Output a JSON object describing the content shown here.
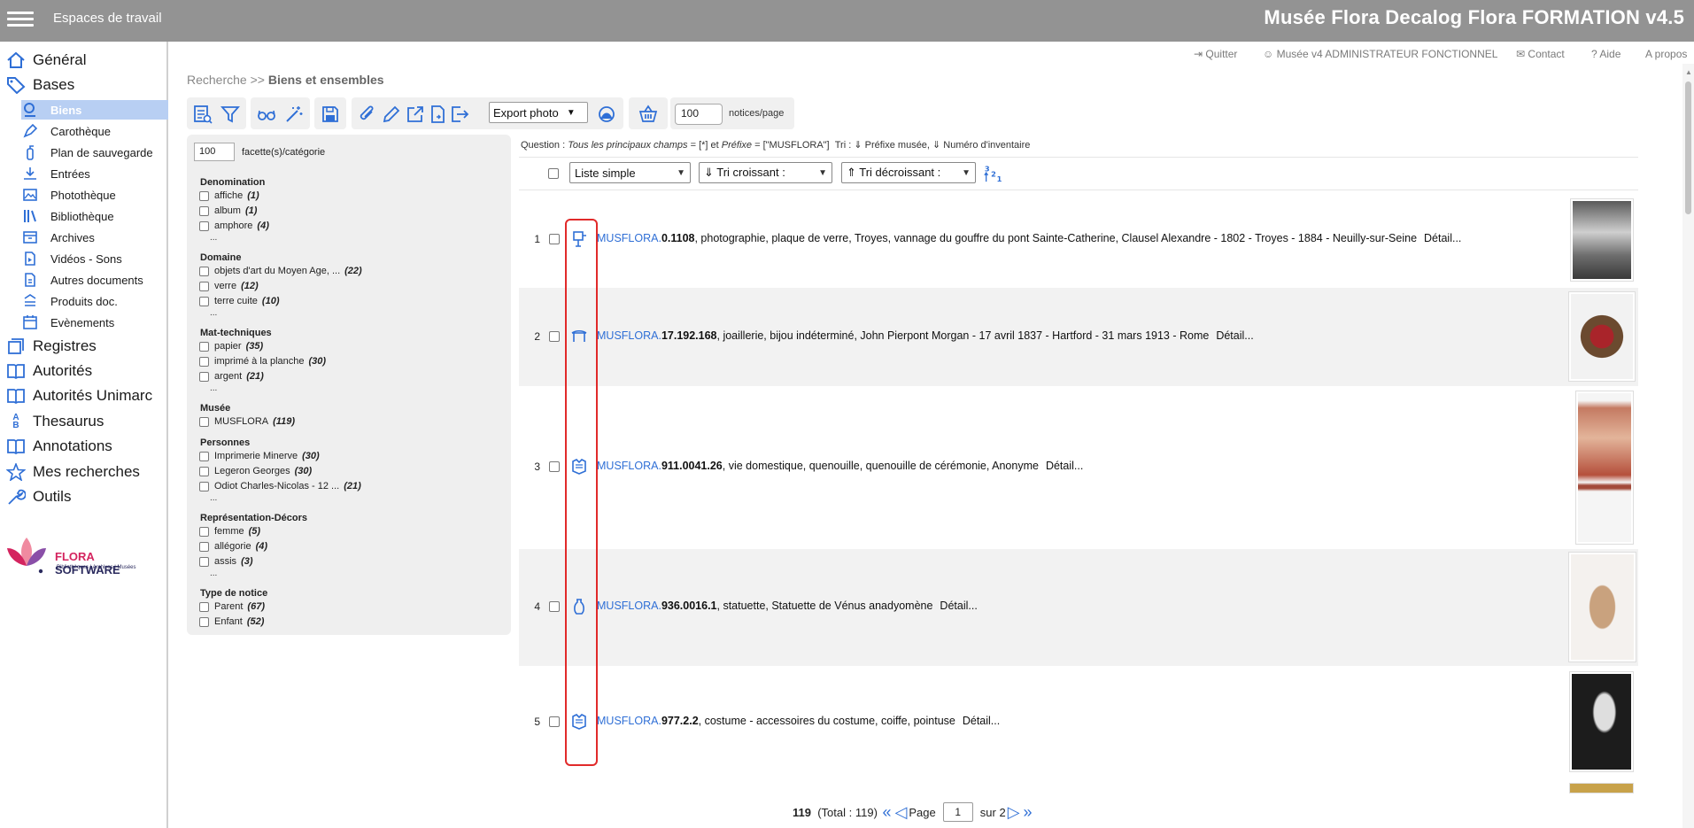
{
  "topbar": {
    "workspace": "Espaces de travail",
    "title": "Musée Flora Decalog Flora FORMATION v4.5"
  },
  "sidebar": {
    "top_items": [
      {
        "label": "Général",
        "icon": "home-icon"
      },
      {
        "label": "Bases",
        "icon": "tag-icon"
      }
    ],
    "sub_items": [
      {
        "label": "Biens",
        "icon": "object-search-icon",
        "active": true
      },
      {
        "label": "Carothèque",
        "icon": "pen-icon"
      },
      {
        "label": "Plan de sauvegarde",
        "icon": "extinguisher-icon"
      },
      {
        "label": "Entrées",
        "icon": "download-icon"
      },
      {
        "label": "Photothèque",
        "icon": "photo-icon"
      },
      {
        "label": "Bibliothèque",
        "icon": "books-icon"
      },
      {
        "label": "Archives",
        "icon": "archive-box-icon"
      },
      {
        "label": "Vidéos - Sons",
        "icon": "media-file-icon"
      },
      {
        "label": "Autres documents",
        "icon": "document-icon"
      },
      {
        "label": "Produits doc.",
        "icon": "stack-icon"
      },
      {
        "label": "Evènements",
        "icon": "calendar-icon"
      }
    ],
    "bottom_items": [
      {
        "label": "Registres",
        "icon": "registers-icon"
      },
      {
        "label": "Autorités",
        "icon": "book-open-icon"
      },
      {
        "label": "Autorités Unimarc",
        "icon": "book-open-icon"
      },
      {
        "label": "Thesaurus",
        "icon": "sort-az-icon"
      },
      {
        "label": "Annotations",
        "icon": "book-open-icon"
      },
      {
        "label": "Mes recherches",
        "icon": "star-icon"
      },
      {
        "label": "Outils",
        "icon": "wrench-icon"
      }
    ],
    "logo": {
      "brand_a": "FLORA",
      "brand_b": "SOFTWARE",
      "tagline": "Bibliothèques | Archives | Musées"
    }
  },
  "utils": {
    "quit": "Quitter",
    "user": "Musée v4 ADMINISTRATEUR FONCTIONNEL",
    "contact": "Contact",
    "help": "Aide",
    "about": "A propos"
  },
  "breadcrumb": {
    "root": "Recherche",
    "sep": ">>",
    "current": "Biens et ensembles"
  },
  "toolbar": {
    "export_value": "Export photo",
    "per_page_value": "100",
    "per_page_label": "notices/page"
  },
  "facets": {
    "count_value": "100",
    "count_label": "facette(s)/catégorie",
    "groups": [
      {
        "title": "Denomination",
        "items": [
          {
            "label": "affiche",
            "count": "(1)"
          },
          {
            "label": "album",
            "count": "(1)"
          },
          {
            "label": "amphore",
            "count": "(4)"
          }
        ],
        "more": "..."
      },
      {
        "title": "Domaine",
        "items": [
          {
            "label": "objets d'art du Moyen Age, ...",
            "count": "(22)"
          },
          {
            "label": "verre",
            "count": "(12)"
          },
          {
            "label": "terre cuite",
            "count": "(10)"
          }
        ],
        "more": "..."
      },
      {
        "title": "Mat-techniques",
        "items": [
          {
            "label": "papier",
            "count": "(35)"
          },
          {
            "label": "imprimé à la planche",
            "count": "(30)"
          },
          {
            "label": "argent",
            "count": "(21)"
          }
        ],
        "more": "..."
      },
      {
        "title": "Musée",
        "items": [
          {
            "label": "MUSFLORA",
            "count": "(119)"
          }
        ],
        "more": ""
      },
      {
        "title": "Personnes",
        "items": [
          {
            "label": "Imprimerie Minerve",
            "count": "(30)"
          },
          {
            "label": "Legeron Georges",
            "count": "(30)"
          },
          {
            "label": "Odiot Charles-Nicolas - 12 ...",
            "count": "(21)"
          }
        ],
        "more": "..."
      },
      {
        "title": "Représentation-Décors",
        "items": [
          {
            "label": "femme",
            "count": "(5)"
          },
          {
            "label": "allégorie",
            "count": "(4)"
          },
          {
            "label": "assis",
            "count": "(3)"
          }
        ],
        "more": "..."
      },
      {
        "title": "Type de notice",
        "items": [
          {
            "label": "Parent",
            "count": "(67)"
          },
          {
            "label": "Enfant",
            "count": "(52)"
          }
        ],
        "more": ""
      }
    ]
  },
  "question": {
    "label": "Question :",
    "field1": "Tous les principaux champs",
    "op1": "= [*] et",
    "field2": "Préfixe",
    "op2": "= [\"MUSFLORA\"]",
    "sort_label": "Tri :",
    "sort_value": "⇓ Préfixe musée, ⇓ Numéro d'inventaire"
  },
  "list_controls": {
    "display": "Liste simple",
    "sort_asc": "⇓ Tri croissant :",
    "sort_desc": "⇑ Tri décroissant :"
  },
  "results": [
    {
      "num": "1",
      "icon": "wall-object-icon",
      "prefix": "MUSFLORA.",
      "inventory": "0.1108",
      "desc": ", photographie, plaque de verre, Troyes, vannage du gouffre du pont Sainte-Catherine, Clausel Alexandre - 1802 - Troyes - 1884 - Neuilly-sur-Seine",
      "detail": "Détail..."
    },
    {
      "num": "2",
      "icon": "table-furniture-icon",
      "prefix": "MUSFLORA.",
      "inventory": "17.192.168",
      "desc": ", joaillerie, bijou indéterminé, John Pierpont Morgan - 17 avril 1837 - Hartford - 31 mars 1913 - Rome",
      "detail": "Détail..."
    },
    {
      "num": "3",
      "icon": "costume-icon",
      "prefix": "MUSFLORA.",
      "inventory": "911.0041.26",
      "desc": ", vie domestique, quenouille, quenouille de cérémonie, Anonyme",
      "detail": "Détail..."
    },
    {
      "num": "4",
      "icon": "vase-icon",
      "prefix": "MUSFLORA.",
      "inventory": "936.0016.1",
      "desc": ", statuette, Statuette de Vénus anadyomène",
      "detail": "Détail..."
    },
    {
      "num": "5",
      "icon": "costume-icon",
      "prefix": "MUSFLORA.",
      "inventory": "977.2.2",
      "desc": ", costume - accessoires du costume, coiffe, pointuse",
      "detail": "Détail..."
    }
  ],
  "pager": {
    "count": "119",
    "total": "(Total : 119)",
    "page_label": "Page",
    "page_value": "1",
    "of_label": "sur",
    "pages": "2"
  },
  "colors": {
    "accent": "#2f6fd6",
    "topbar": "#939393",
    "highlight": "#e12a2a",
    "active_nav": "#b8cff3"
  }
}
